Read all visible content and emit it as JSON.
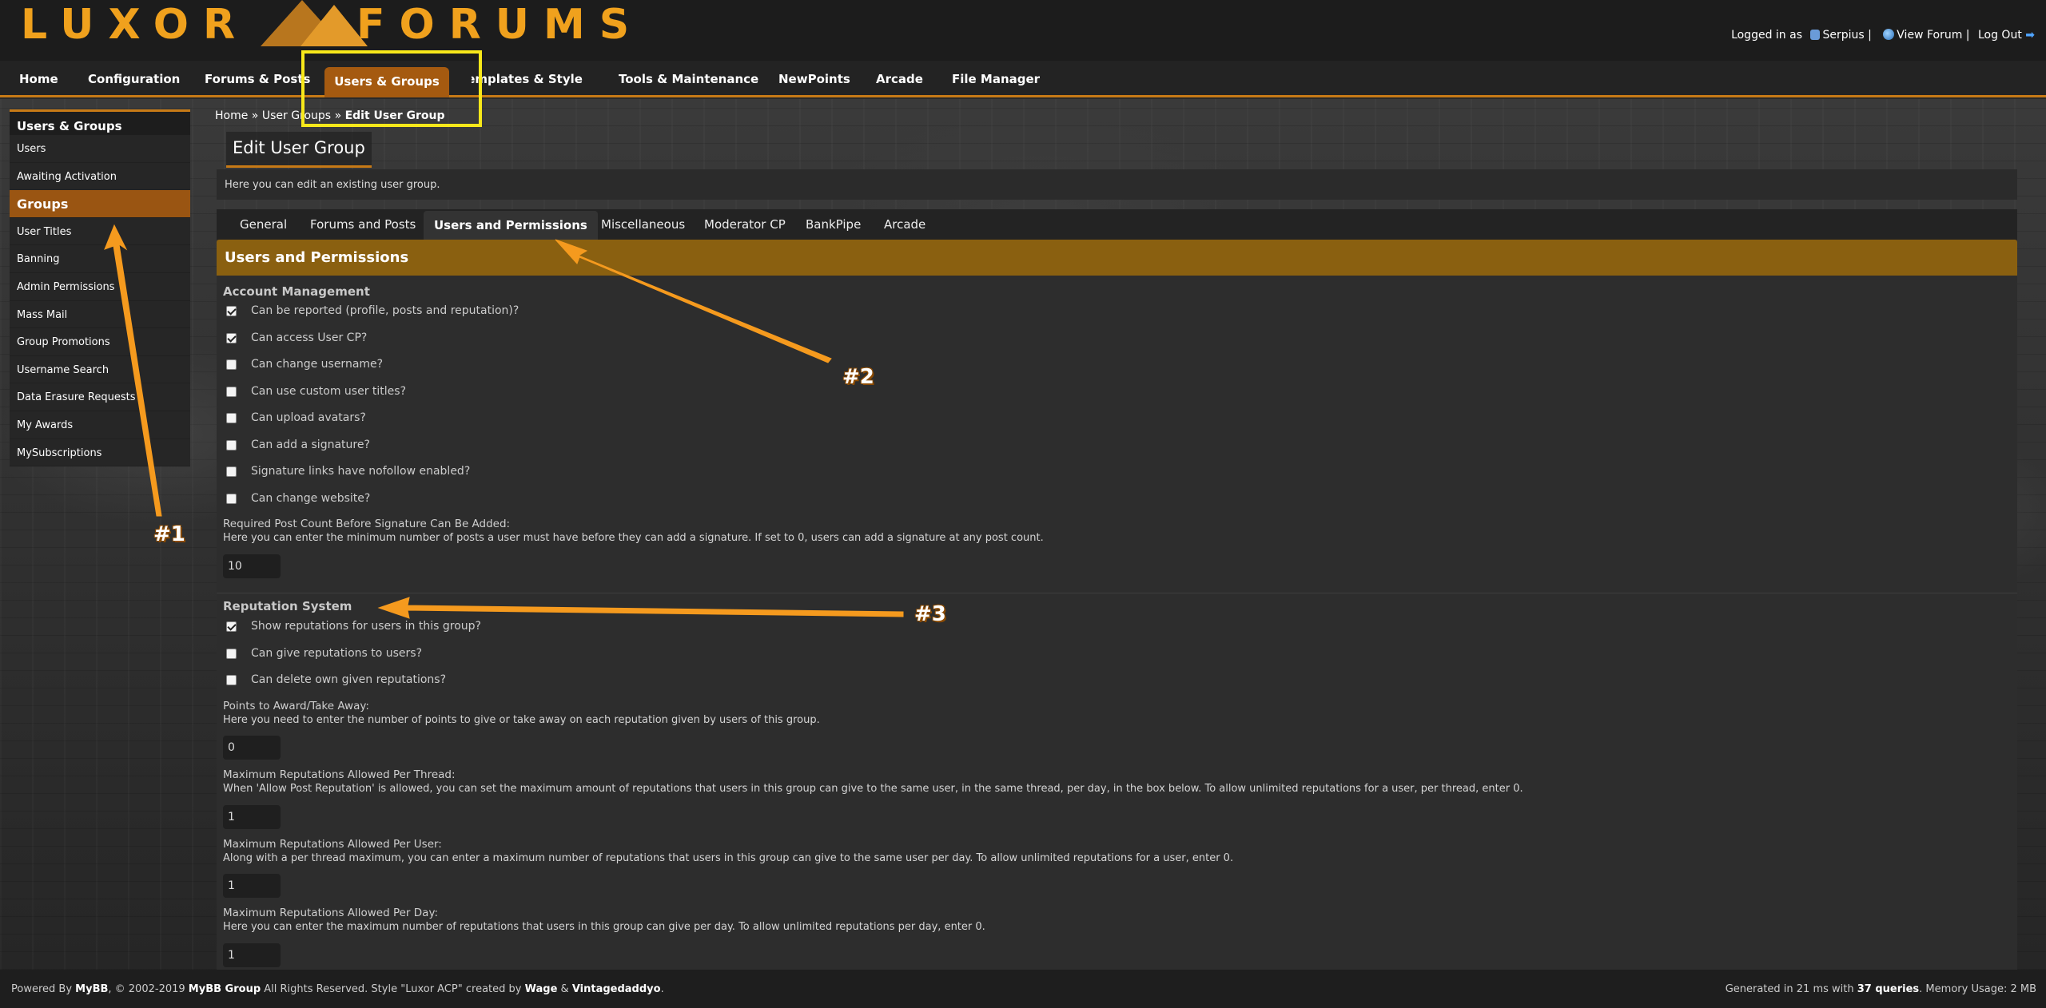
{
  "header": {
    "logo_left": "LUXOR",
    "logo_right": "FORUMS",
    "logged_in_as": "Logged in as",
    "username": "Serpius |",
    "view_forum": "View Forum |",
    "logout": "Log Out"
  },
  "nav": {
    "items": [
      "Home",
      "Configuration",
      "Forums & Posts",
      "Users & Groups",
      "Templates & Style",
      "Tools & Maintenance",
      "NewPoints",
      "Arcade",
      "File Manager"
    ],
    "active": "Users & Groups"
  },
  "sidebar": {
    "title": "Users & Groups",
    "items": [
      "Users",
      "Awaiting Activation",
      "Groups",
      "User Titles",
      "Banning",
      "Admin Permissions",
      "Mass Mail",
      "Group Promotions",
      "Username Search",
      "Data Erasure Requests",
      "My Awards",
      "MySubscriptions"
    ],
    "active": "Groups"
  },
  "breadcrumb": {
    "home": "Home",
    "sep1": "»",
    "user_groups": "User Groups",
    "sep2": "»",
    "current": "Edit User Group"
  },
  "page": {
    "title": "Edit User Group",
    "description": "Here you can edit an existing user group."
  },
  "tabs": [
    "General",
    "Forums and Posts",
    "Users and Permissions",
    "Miscellaneous",
    "Moderator CP",
    "BankPipe",
    "Arcade"
  ],
  "panel": {
    "title": "Users and Permissions",
    "account": {
      "title": "Account Management",
      "options": [
        {
          "label": "Can be reported (profile, posts and reputation)?",
          "checked": true
        },
        {
          "label": "Can access User CP?",
          "checked": true
        },
        {
          "label": "Can change username?",
          "checked": false
        },
        {
          "label": "Can use custom user titles?",
          "checked": false
        },
        {
          "label": "Can upload avatars?",
          "checked": false
        },
        {
          "label": "Can add a signature?",
          "checked": false
        },
        {
          "label": "Signature links have nofollow enabled?",
          "checked": false
        },
        {
          "label": "Can change website?",
          "checked": false
        }
      ],
      "sig_label": "Required Post Count Before Signature Can Be Added:",
      "sig_desc": "Here you can enter the minimum number of posts a user must have before they can add a signature. If set to 0, users can add a signature at any post count.",
      "sig_value": "10"
    },
    "reputation": {
      "title": "Reputation System",
      "options": [
        {
          "label": "Show reputations for users in this group?",
          "checked": true
        },
        {
          "label": "Can give reputations to users?",
          "checked": false
        },
        {
          "label": "Can delete own given reputations?",
          "checked": false
        }
      ],
      "fields": [
        {
          "label": "Points to Award/Take Away:",
          "desc": "Here you need to enter the number of points to give or take away on each reputation given by users of this group.",
          "value": "0"
        },
        {
          "label": "Maximum Reputations Allowed Per Thread:",
          "desc": "When 'Allow Post Reputation' is allowed, you can set the maximum amount of reputations that users in this group can give to the same user, in the same thread, per day, in the box below. To allow unlimited reputations for a user, per thread, enter 0.",
          "value": "1"
        },
        {
          "label": "Maximum Reputations Allowed Per User:",
          "desc": "Along with a per thread maximum, you can enter a maximum number of reputations that users in this group can give to the same user per day. To allow unlimited reputations for a user, enter 0.",
          "value": "1"
        },
        {
          "label": "Maximum Reputations Allowed Per Day:",
          "desc": "Here you can enter the maximum number of reputations that users in this group can give per day. To allow unlimited reputations per day, enter 0.",
          "value": "1"
        }
      ]
    }
  },
  "footer": {
    "powered_by": "Powered By",
    "mybb": "MyBB",
    "copyright": ", © 2002-2019",
    "mybb_group": "MyBB Group",
    "rights": "All Rights Reserved.  Style \"Luxor ACP\" created by",
    "wage": "Wage",
    "amp": "&",
    "vintage": "Vintagedaddyo",
    "dot": ".",
    "generated": "Generated in 21 ms with",
    "queries": "37 queries",
    "memory": ". Memory Usage: 2 MB"
  },
  "annotations": [
    "#1",
    "#2",
    "#3"
  ],
  "colors": {
    "accent": "#c77a16",
    "annotation": "#f59a1e",
    "highlight_box": "#f7e81a",
    "panel_head": "#8a6010"
  }
}
